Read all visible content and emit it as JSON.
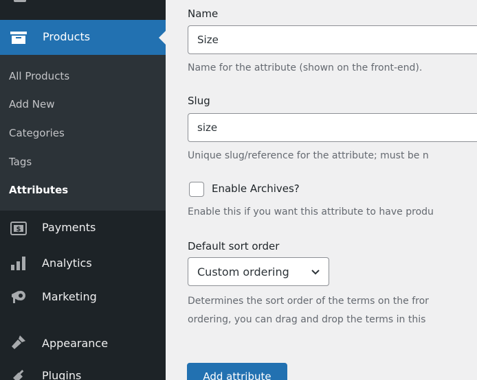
{
  "sidebar": {
    "current": {
      "label": "Products",
      "icon": "products-icon"
    },
    "submenu": [
      {
        "label": "All Products"
      },
      {
        "label": "Add New"
      },
      {
        "label": "Categories"
      },
      {
        "label": "Tags"
      },
      {
        "label": "Attributes",
        "current": true
      }
    ],
    "items": [
      {
        "label": "Payments",
        "icon": "payments-icon"
      },
      {
        "label": "Analytics",
        "icon": "analytics-icon"
      },
      {
        "label": "Marketing",
        "icon": "marketing-icon"
      },
      {
        "label": "Appearance",
        "icon": "appearance-icon"
      },
      {
        "label": "Plugins",
        "icon": "plugins-icon"
      }
    ],
    "colors": {
      "background": "#1d2327",
      "submenu_background": "#2c3338",
      "current_background": "#2271b1"
    }
  },
  "form": {
    "name": {
      "label": "Name",
      "value": "Size",
      "description": "Name for the attribute (shown on the front-end)."
    },
    "slug": {
      "label": "Slug",
      "value": "size",
      "description": "Unique slug/reference for the attribute; must be n"
    },
    "archives": {
      "label": "Enable Archives?",
      "checked": false,
      "description": "Enable this if you want this attribute to have produ"
    },
    "sort_order": {
      "label": "Default sort order",
      "value": "Custom ordering",
      "description_line1": "Determines the sort order of the terms on the fror",
      "description_line2": "ordering, you can drag and drop the terms in this"
    },
    "submit_label": "Add attribute"
  },
  "accent_color": "#2271b1"
}
